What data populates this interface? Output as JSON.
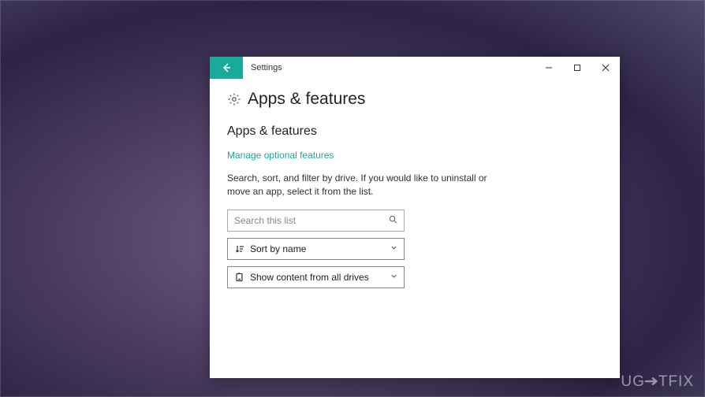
{
  "window": {
    "title": "Settings"
  },
  "page": {
    "title": "Apps & features",
    "section_title": "Apps & features",
    "optional_features_link": "Manage optional features",
    "description": "Search, sort, and filter by drive. If you would like to uninstall or move an app, select it from the list.",
    "search_placeholder": "Search this list",
    "sort_label": "Sort by name",
    "filter_label": "Show content from all drives"
  },
  "watermark": "UG→TFIX"
}
